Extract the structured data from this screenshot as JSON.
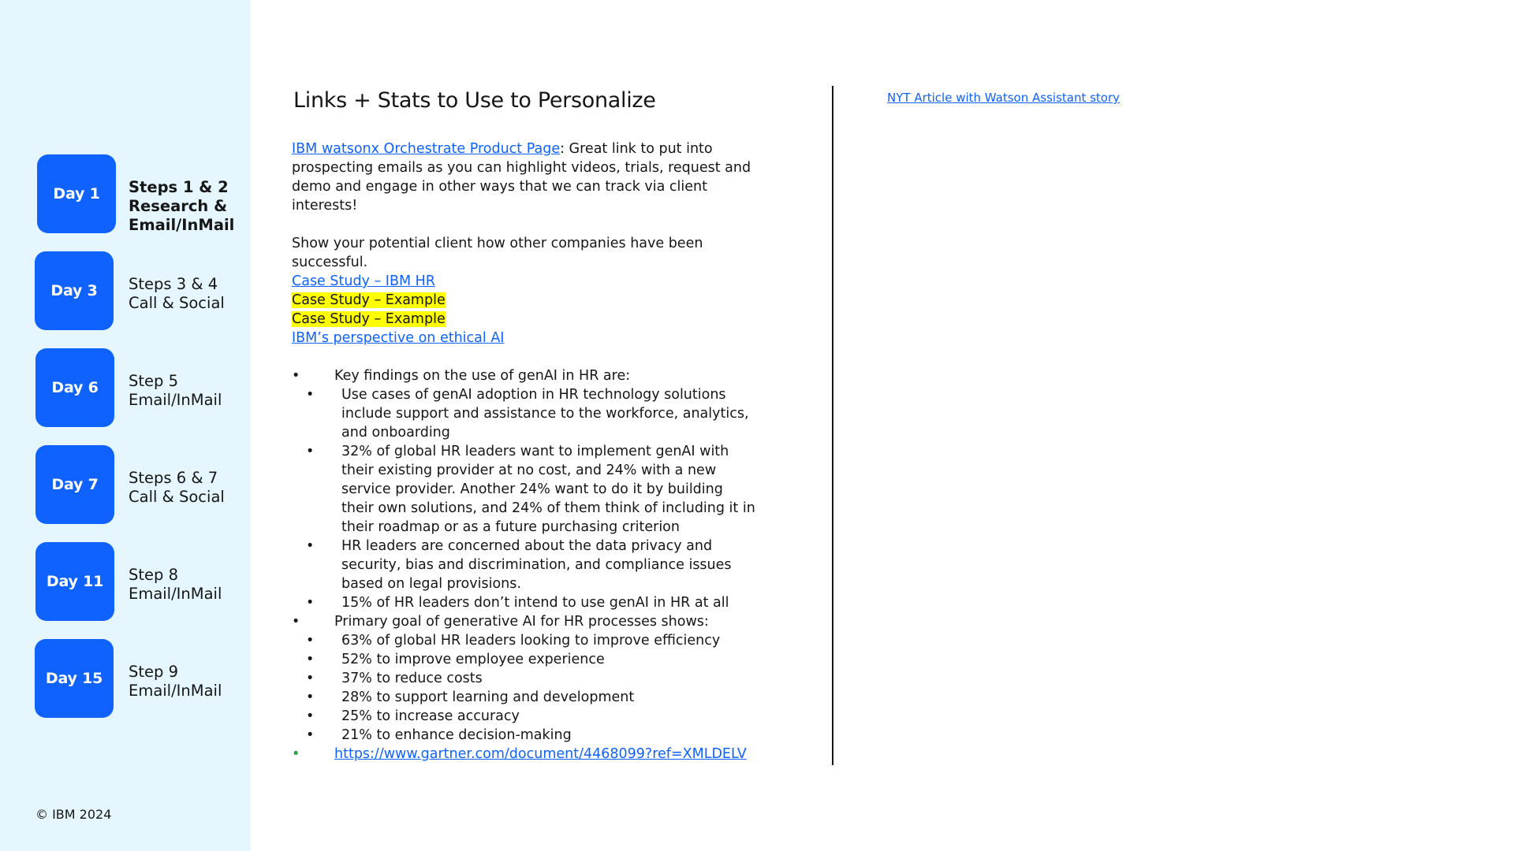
{
  "sidebar": {
    "days": [
      {
        "badge": "Day 1",
        "lines": [
          "Steps 1 & 2",
          "Research &",
          "Email/InMail"
        ],
        "bold": true
      },
      {
        "badge": "Day 3",
        "lines": [
          "Steps 3 & 4",
          "Call & Social"
        ],
        "bold": false
      },
      {
        "badge": "Day 6",
        "lines": [
          "Step 5",
          "Email/InMail"
        ],
        "bold": false
      },
      {
        "badge": "Day 7",
        "lines": [
          "Steps 6 & 7",
          "Call & Social"
        ],
        "bold": false
      },
      {
        "badge": "Day 11",
        "lines": [
          "Step 8",
          "Email/InMail"
        ],
        "bold": false
      },
      {
        "badge": "Day 15",
        "lines": [
          "Step 9",
          "Email/InMail"
        ],
        "bold": false
      }
    ],
    "copyright": "© IBM 2024"
  },
  "main": {
    "title": "Links + Stats to Use to Personalize",
    "intro_link": "IBM watsonx Orchestrate Product Page",
    "intro_text": ": Great link to put into prospecting emails as you can highlight videos, trials, request and demo and engage in other ways that we can track via client interests!",
    "success_text": "Show your potential client how other companies have been successful.",
    "links": [
      {
        "text": "Case Study – IBM HR",
        "highlight": false
      },
      {
        "text": "Case Study – Example",
        "highlight": true
      },
      {
        "text": "Case Study – Example",
        "highlight": true
      },
      {
        "text": "IBM’s perspective on ethical AI",
        "highlight": false
      }
    ],
    "key_findings": {
      "heading": "Key findings on the use of genAI in HR are:",
      "items": [
        "Use cases of genAI adoption in HR technology solutions include support and assistance to the workforce, analytics, and onboarding",
        "32% of global HR leaders want to implement genAI with their existing provider at no cost, and 24% with a new service provider. Another 24% want to do it by building their own solutions, and 24% of them think of including it in their roadmap or as a future purchasing criterion",
        "HR leaders are concerned about the data privacy and security, bias and discrimination, and compliance issues based on legal provisions.",
        "15% of HR leaders don’t intend to use genAI in HR at all"
      ]
    },
    "primary_goal": {
      "heading": "Primary goal of generative AI for HR processes shows:",
      "items": [
        "63% of global HR leaders looking to improve efficiency",
        "52% to improve employee experience",
        "37% to reduce costs",
        "28% to support learning and development",
        "25% to increase accuracy",
        "21% to enhance decision-making"
      ]
    },
    "source_link": "https://www.gartner.com/document/4468099?ref=XMLDELV"
  },
  "right": {
    "link": "NYT Article with Watson Assistant story"
  },
  "colors": {
    "sidebar_bg": "#e5f6ff",
    "badge_blue": "#0f62fe",
    "link_blue": "#0f62fe",
    "highlight": "#ffff00"
  }
}
